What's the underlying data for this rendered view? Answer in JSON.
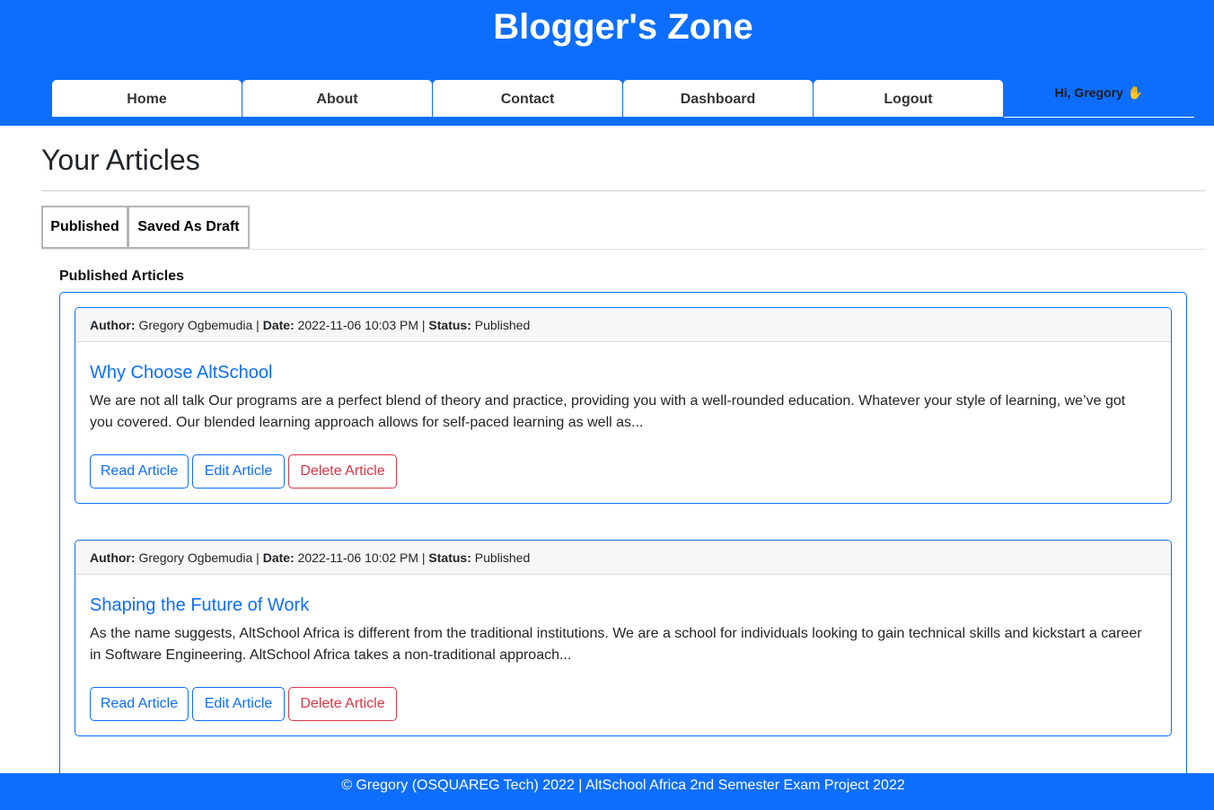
{
  "site": {
    "title": "Blogger's Zone"
  },
  "nav": {
    "items": [
      {
        "label": "Home"
      },
      {
        "label": "About"
      },
      {
        "label": "Contact"
      },
      {
        "label": "Dashboard"
      },
      {
        "label": "Logout"
      }
    ],
    "greeting": "Hi, Gregory",
    "greeting_icon": "waving-hand-icon"
  },
  "page": {
    "heading": "Your Articles",
    "tabs": [
      {
        "label": "Published"
      },
      {
        "label": "Saved As Draft"
      }
    ],
    "section_label": "Published Articles"
  },
  "articles": [
    {
      "author_label": "Author:",
      "author": "Gregory Ogbemudia",
      "date_label": "Date:",
      "date": "2022-11-06 10:03 PM",
      "status_label": "Status:",
      "status": "Published",
      "title": "Why Choose AltSchool",
      "excerpt": "We are not all talk Our programs are a perfect blend of theory and practice, providing you with a well-rounded education. Whatever your style of learning, we’ve got you covered. Our blended learning approach allows for self-paced learning as well as...",
      "read_label": "Read Article",
      "edit_label": "Edit Article",
      "delete_label": "Delete Article"
    },
    {
      "author_label": "Author:",
      "author": "Gregory Ogbemudia",
      "date_label": "Date:",
      "date": "2022-11-06 10:02 PM",
      "status_label": "Status:",
      "status": "Published",
      "title": "Shaping the Future of Work",
      "excerpt": "As the name suggests, AltSchool Africa is different from the traditional institutions. We are a school for individuals looking to gain technical skills and kickstart a career in Software Engineering. AltSchool Africa takes a non-traditional approach...",
      "read_label": "Read Article",
      "edit_label": "Edit Article",
      "delete_label": "Delete Article"
    }
  ],
  "footer": {
    "text": "© Gregory (OSQUAREG Tech) 2022 | AltSchool Africa 2nd Semester Exam Project 2022"
  },
  "colors": {
    "primary": "#0d6efd",
    "danger": "#dc3545",
    "card_header_bg": "#f7f7f7"
  }
}
